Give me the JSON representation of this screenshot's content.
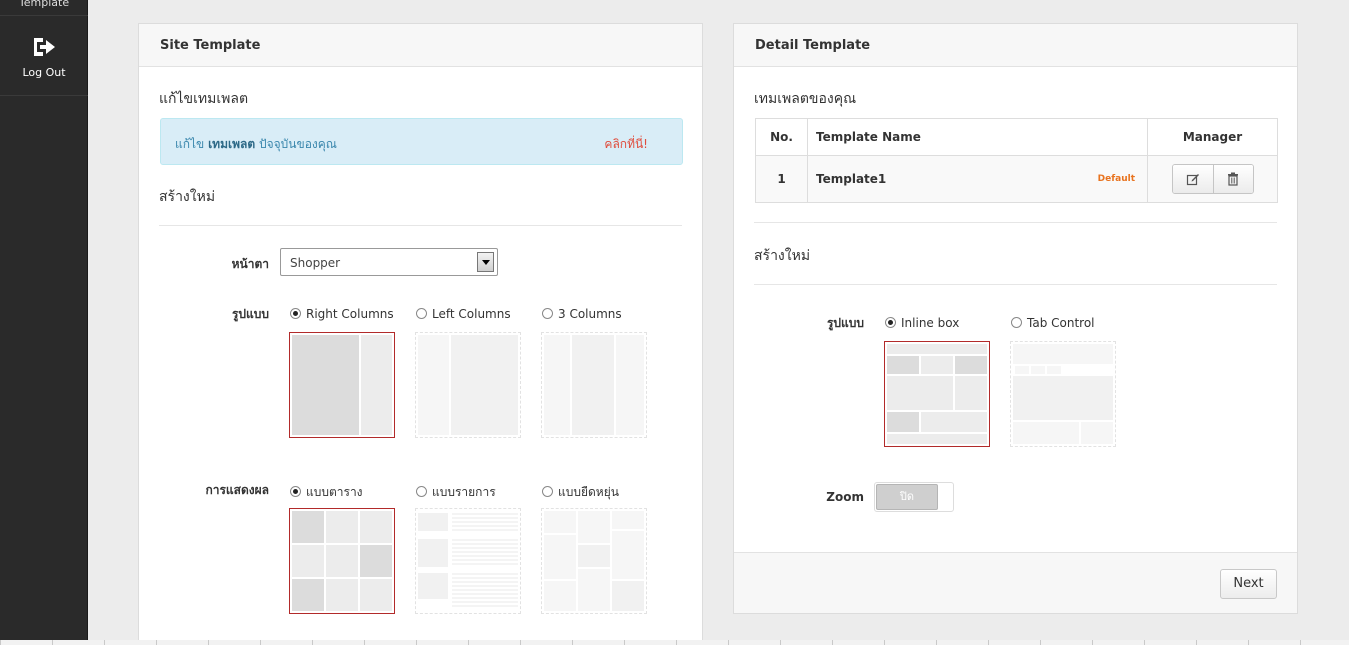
{
  "sidebar": {
    "top_item": "Template",
    "logout": "Log Out"
  },
  "site_template": {
    "title": "Site Template",
    "edit_heading": "แก้ไขเทมเพลต",
    "alert_prefix": "แก้ไข",
    "alert_bold": "เทมเพลต",
    "alert_suffix": "ปัจจุบันของคุณ",
    "alert_link": "คลิกที่นี่!",
    "create_heading": "สร้างใหม่",
    "theme_label": "หน้าตา",
    "theme_value": "Shopper",
    "layout_label": "รูปแบบ",
    "layout_options": [
      "Right Columns",
      "Left Columns",
      "3 Columns"
    ],
    "layout_selected": "Right Columns",
    "display_label": "การแสดงผล",
    "display_options": [
      "แบบตาราง",
      "แบบรายการ",
      "แบบยืดหยุ่น"
    ],
    "display_selected": "แบบตาราง"
  },
  "detail_template": {
    "title": "Detail Template",
    "your_templates_heading": "เทมเพลตของคุณ",
    "table": {
      "headers": [
        "No.",
        "Template Name",
        "Manager"
      ],
      "rows": [
        {
          "no": "1",
          "name": "Template1",
          "tag": "Default"
        }
      ]
    },
    "create_heading": "สร้างใหม่",
    "layout_label": "รูปแบบ",
    "layout_options": [
      "Inline box",
      "Tab Control"
    ],
    "layout_selected": "Inline box",
    "zoom_label": "Zoom",
    "zoom_state": "ปิด",
    "next_button": "Next"
  },
  "colors": {
    "selected_border": "#b22a2a",
    "alert_bg": "#d9edf7",
    "alert_text": "#3a87ad",
    "link_red": "#e04c3c",
    "default_tag": "#e8731f",
    "sidebar_bg": "#2a2a2a"
  }
}
